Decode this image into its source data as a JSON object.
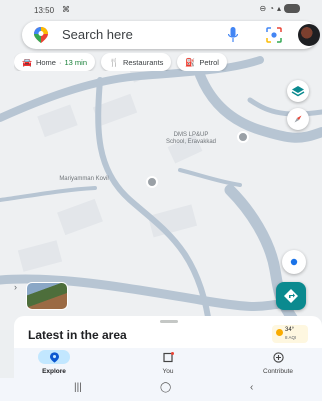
{
  "status_bar": {
    "time": "13:50",
    "extra": "⌘"
  },
  "search": {
    "placeholder": "Search here"
  },
  "chips": [
    {
      "icon": "car-icon",
      "label": "Home",
      "eta": "13 min"
    },
    {
      "icon": "fork-knife-icon",
      "label": "Restaurants"
    },
    {
      "icon": "fuel-pump-icon",
      "label": "Petrol"
    }
  ],
  "map": {
    "labels": [
      {
        "text": "DMS LP&UP\nSchool, Eravakkad"
      },
      {
        "text": "Mariyamman Kovil\n"
      }
    ]
  },
  "sheet": {
    "title": "Latest in the area"
  },
  "weather": {
    "temp": "34°",
    "aqi": "8 AQI"
  },
  "nav": {
    "items": [
      {
        "label": "Explore",
        "icon": "pin-icon",
        "active": true
      },
      {
        "label": "You",
        "icon": "saved-flag-icon",
        "active": false
      },
      {
        "label": "Contribute",
        "icon": "plus-circle-icon",
        "active": false
      }
    ]
  },
  "colors": {
    "accent": "#0b8a8f",
    "explore_active": "#c2e7ff",
    "road": "#b7c5d3"
  }
}
